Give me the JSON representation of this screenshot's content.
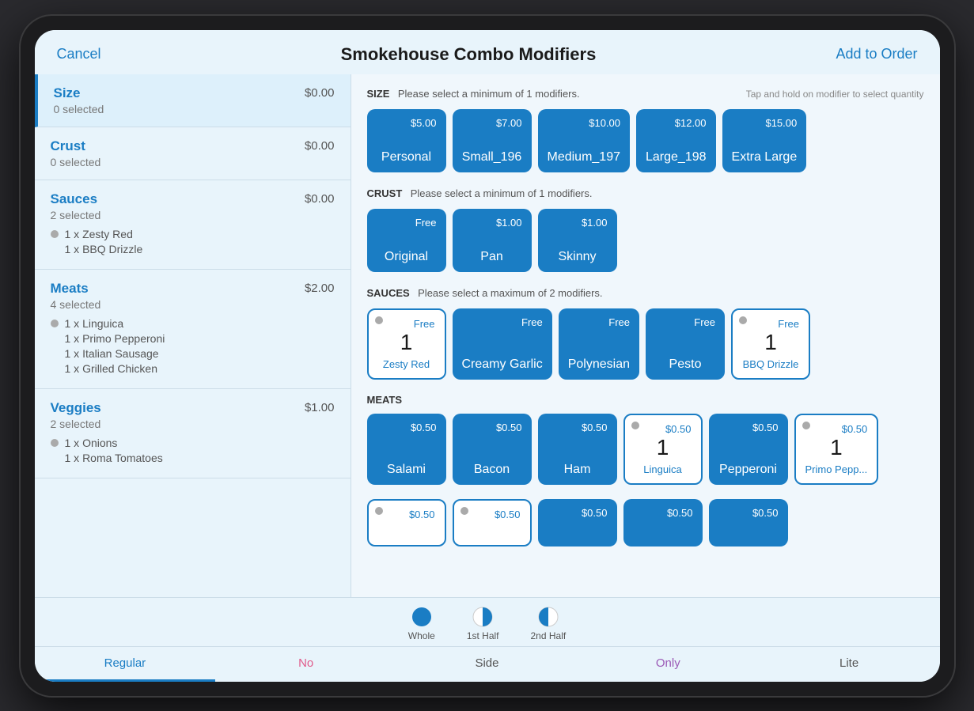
{
  "header": {
    "cancel_label": "Cancel",
    "title": "Smokehouse Combo Modifiers",
    "add_order_label": "Add to Order"
  },
  "sidebar": {
    "items": [
      {
        "id": "size",
        "name": "Size",
        "sub": "0 selected",
        "price": "$0.00",
        "active": true,
        "sub_items": []
      },
      {
        "id": "crust",
        "name": "Crust",
        "sub": "0 selected",
        "price": "$0.00",
        "active": false,
        "sub_items": []
      },
      {
        "id": "sauces",
        "name": "Sauces",
        "sub": "2 selected",
        "price": "$0.00",
        "active": false,
        "sub_items": [
          {
            "label": "1 x Zesty Red"
          },
          {
            "label": "1 x BBQ Drizzle"
          }
        ]
      },
      {
        "id": "meats",
        "name": "Meats",
        "sub": "4 selected",
        "price": "$2.00",
        "active": false,
        "sub_items": [
          {
            "label": "1 x Linguica"
          },
          {
            "label": "1 x Primo Pepperoni"
          },
          {
            "label": "1 x Italian Sausage"
          },
          {
            "label": "1 x Grilled Chicken"
          }
        ]
      },
      {
        "id": "veggies",
        "name": "Veggies",
        "sub": "2 selected",
        "price": "$1.00",
        "active": false,
        "sub_items": [
          {
            "label": "1 x Onions"
          },
          {
            "label": "1 x Roma Tomatoes"
          }
        ]
      }
    ]
  },
  "sections": {
    "size": {
      "label": "SIZE",
      "instruction": "Please select a minimum of 1 modifiers.",
      "hint": "Tap and hold on modifier to select quantity",
      "modifiers": [
        {
          "name": "Personal",
          "price": "$5.00",
          "outlined": false,
          "qty": null,
          "has_dot": false
        },
        {
          "name": "Small_196",
          "price": "$7.00",
          "outlined": false,
          "qty": null,
          "has_dot": false
        },
        {
          "name": "Medium_197",
          "price": "$10.00",
          "outlined": false,
          "qty": null,
          "has_dot": false
        },
        {
          "name": "Large_198",
          "price": "$12.00",
          "outlined": false,
          "qty": null,
          "has_dot": false
        },
        {
          "name": "Extra Large",
          "price": "$15.00",
          "outlined": false,
          "qty": null,
          "has_dot": false
        }
      ]
    },
    "crust": {
      "label": "CRUST",
      "instruction": "Please select a minimum of 1 modifiers.",
      "modifiers": [
        {
          "name": "Original",
          "price": "Free",
          "outlined": false,
          "qty": null,
          "has_dot": false
        },
        {
          "name": "Pan",
          "price": "$1.00",
          "outlined": false,
          "qty": null,
          "has_dot": false
        },
        {
          "name": "Skinny",
          "price": "$1.00",
          "outlined": false,
          "qty": null,
          "has_dot": false
        }
      ]
    },
    "sauces": {
      "label": "SAUCES",
      "instruction": "Please select a maximum of 2 modifiers.",
      "modifiers": [
        {
          "name": "Zesty Red",
          "price": "Free",
          "outlined": true,
          "qty": "1",
          "has_dot": true
        },
        {
          "name": "Creamy Garlic",
          "price": "Free",
          "outlined": false,
          "qty": null,
          "has_dot": false
        },
        {
          "name": "Polynesian",
          "price": "Free",
          "outlined": false,
          "qty": null,
          "has_dot": false
        },
        {
          "name": "Pesto",
          "price": "Free",
          "outlined": false,
          "qty": null,
          "has_dot": false
        },
        {
          "name": "BBQ Drizzle",
          "price": "Free",
          "outlined": true,
          "qty": "1",
          "has_dot": true
        }
      ]
    },
    "meats": {
      "label": "MEATS",
      "modifiers_row1": [
        {
          "name": "Salami",
          "price": "$0.50",
          "outlined": false,
          "qty": null,
          "has_dot": false
        },
        {
          "name": "Bacon",
          "price": "$0.50",
          "outlined": false,
          "qty": null,
          "has_dot": false
        },
        {
          "name": "Ham",
          "price": "$0.50",
          "outlined": false,
          "qty": null,
          "has_dot": false
        },
        {
          "name": "Linguica",
          "price": "$0.50",
          "outlined": true,
          "qty": "1",
          "has_dot": true
        },
        {
          "name": "Pepperoni",
          "price": "$0.50",
          "outlined": false,
          "qty": null,
          "has_dot": false
        },
        {
          "name": "Primo Pepp...",
          "price": "$0.50",
          "outlined": true,
          "qty": "1",
          "has_dot": true
        }
      ],
      "modifiers_row2": [
        {
          "name": "",
          "price": "$0.50",
          "outlined": true,
          "qty": null,
          "has_dot": true
        },
        {
          "name": "",
          "price": "$0.50",
          "outlined": true,
          "qty": null,
          "has_dot": true
        },
        {
          "name": "",
          "price": "$0.50",
          "outlined": false,
          "qty": null,
          "has_dot": false
        },
        {
          "name": "",
          "price": "$0.50",
          "outlined": false,
          "qty": null,
          "has_dot": false
        },
        {
          "name": "",
          "price": "$0.50",
          "outlined": false,
          "qty": null,
          "has_dot": false
        }
      ]
    }
  },
  "bottom": {
    "portions": [
      {
        "label": "Whole",
        "active": true
      },
      {
        "label": "1st Half",
        "active": false
      },
      {
        "label": "2nd Half",
        "active": false
      }
    ],
    "regular_tabs": [
      {
        "label": "Regular",
        "style": "active"
      },
      {
        "label": "No",
        "style": "pink"
      },
      {
        "label": "Side",
        "style": "default"
      },
      {
        "label": "Only",
        "style": "purple"
      },
      {
        "label": "Lite",
        "style": "default"
      }
    ]
  }
}
